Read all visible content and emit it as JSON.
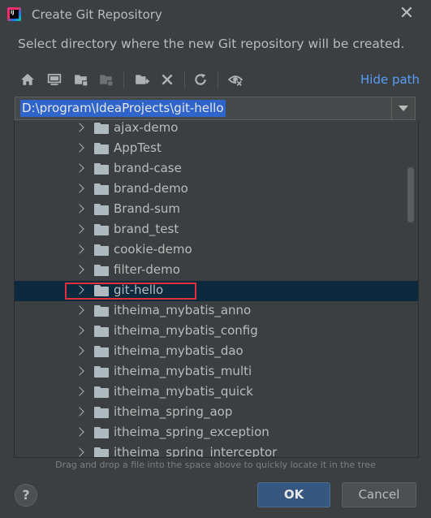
{
  "window": {
    "title": "Create Git Repository",
    "close_icon": "close-icon"
  },
  "description": "Select directory where the new Git repository will be created.",
  "toolbar": {
    "buttons": [
      {
        "name": "home-icon"
      },
      {
        "name": "desktop-icon"
      },
      {
        "name": "project-folder-icon"
      },
      {
        "name": "module-folder-icon"
      },
      {
        "name": "new-folder-icon"
      },
      {
        "name": "delete-icon"
      },
      {
        "name": "refresh-icon"
      },
      {
        "name": "show-hidden-icon"
      }
    ],
    "hide_path_label": "Hide path"
  },
  "path_field": {
    "value": "D:\\program\\IdeaProjects\\git-hello"
  },
  "tree": {
    "items": [
      {
        "label": "ajax-demo",
        "selected": false
      },
      {
        "label": "AppTest",
        "selected": false
      },
      {
        "label": "brand-case",
        "selected": false
      },
      {
        "label": "brand-demo",
        "selected": false
      },
      {
        "label": "Brand-sum",
        "selected": false
      },
      {
        "label": "brand_test",
        "selected": false
      },
      {
        "label": "cookie-demo",
        "selected": false
      },
      {
        "label": "filter-demo",
        "selected": false
      },
      {
        "label": "git-hello",
        "selected": true
      },
      {
        "label": "itheima_mybatis_anno",
        "selected": false
      },
      {
        "label": "itheima_mybatis_config",
        "selected": false
      },
      {
        "label": "itheima_mybatis_dao",
        "selected": false
      },
      {
        "label": "itheima_mybatis_multi",
        "selected": false
      },
      {
        "label": "itheima_mybatis_quick",
        "selected": false
      },
      {
        "label": "itheima_spring_aop",
        "selected": false
      },
      {
        "label": "itheima_spring_exception",
        "selected": false
      },
      {
        "label": "itheima_spring_interceptor",
        "selected": false
      }
    ]
  },
  "hint": "Drag and drop a file into the space above to quickly locate it in the tree",
  "buttons": {
    "help": "?",
    "ok": "OK",
    "cancel": "Cancel"
  },
  "colors": {
    "accent": "#589df6",
    "selection": "#0d293e",
    "ok_bg": "#365880",
    "highlight": "#e0313a"
  }
}
